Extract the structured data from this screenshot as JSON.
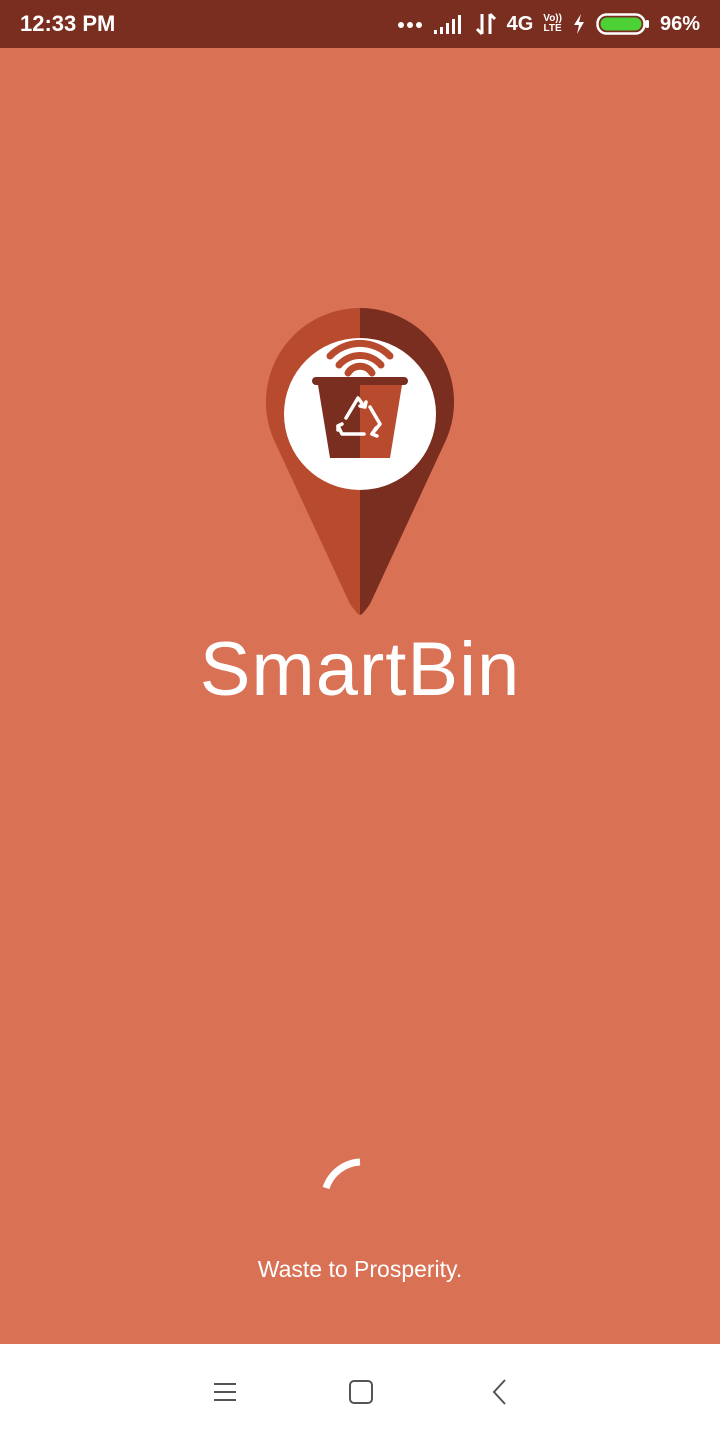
{
  "status_bar": {
    "time": "12:33 PM",
    "network": "4G",
    "volte_top": "Vo))",
    "volte_bottom": "LTE",
    "battery_percent": "96%",
    "icons": [
      "more-dots-icon",
      "signal-icon",
      "data-arrows-icon",
      "volte-icon",
      "charging-icon",
      "battery-icon"
    ]
  },
  "splash": {
    "app_name": "SmartBin",
    "tagline": "Waste to Prosperity.",
    "logo_icon": "smartbin-pin-logo-icon",
    "loading_icon": "loading-spinner-icon"
  },
  "nav_bar": {
    "buttons": [
      "menu-icon",
      "home-icon",
      "back-icon"
    ]
  },
  "colors": {
    "background": "#D97155",
    "status_bar": "#7A2E20",
    "pin_light": "#B84A2E",
    "pin_dark": "#7A2E20",
    "battery_fill": "#4CD137"
  }
}
